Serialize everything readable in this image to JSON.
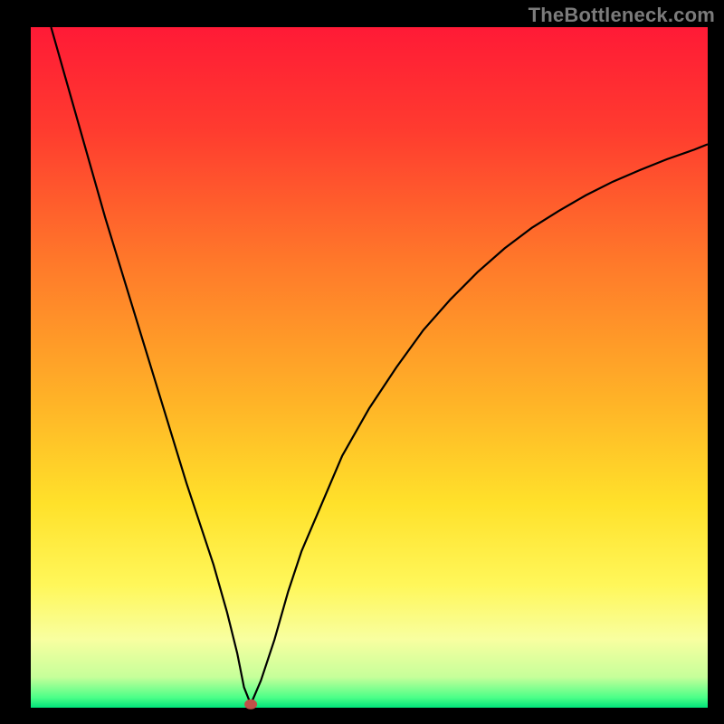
{
  "watermark": "TheBottleneck.com",
  "colors": {
    "frame_bg": "#000000",
    "curve": "#000000",
    "dot_fill": "#c05048",
    "gradient_stops": [
      {
        "offset": 0.0,
        "color": "#ff1a36"
      },
      {
        "offset": 0.15,
        "color": "#ff3b2f"
      },
      {
        "offset": 0.35,
        "color": "#ff7a2a"
      },
      {
        "offset": 0.55,
        "color": "#ffb327"
      },
      {
        "offset": 0.7,
        "color": "#ffe12a"
      },
      {
        "offset": 0.82,
        "color": "#fff75a"
      },
      {
        "offset": 0.9,
        "color": "#f8ffa0"
      },
      {
        "offset": 0.955,
        "color": "#c6ff9a"
      },
      {
        "offset": 0.985,
        "color": "#4cff88"
      },
      {
        "offset": 1.0,
        "color": "#00e37a"
      }
    ]
  },
  "chart_data": {
    "type": "line",
    "title": "",
    "xlabel": "",
    "ylabel": "",
    "xlim": [
      0,
      100
    ],
    "ylim": [
      0,
      100
    ],
    "x": [
      3,
      5,
      7,
      9,
      11,
      13,
      15,
      17,
      19,
      21,
      23,
      25,
      27,
      29,
      30.5,
      31.5,
      32.5,
      34,
      36,
      38,
      40,
      43,
      46,
      50,
      54,
      58,
      62,
      66,
      70,
      74,
      78,
      82,
      86,
      90,
      94,
      98,
      100
    ],
    "values": [
      100,
      93,
      86,
      79,
      72,
      65.5,
      59,
      52.5,
      46,
      39.5,
      33,
      27,
      21,
      14,
      8,
      3,
      0.5,
      4,
      10,
      17,
      23,
      30,
      37,
      44,
      50,
      55.5,
      60,
      64,
      67.5,
      70.5,
      73,
      75.3,
      77.3,
      79,
      80.6,
      82,
      82.8
    ],
    "dot": {
      "x": 32.5,
      "y": 0.5
    }
  }
}
